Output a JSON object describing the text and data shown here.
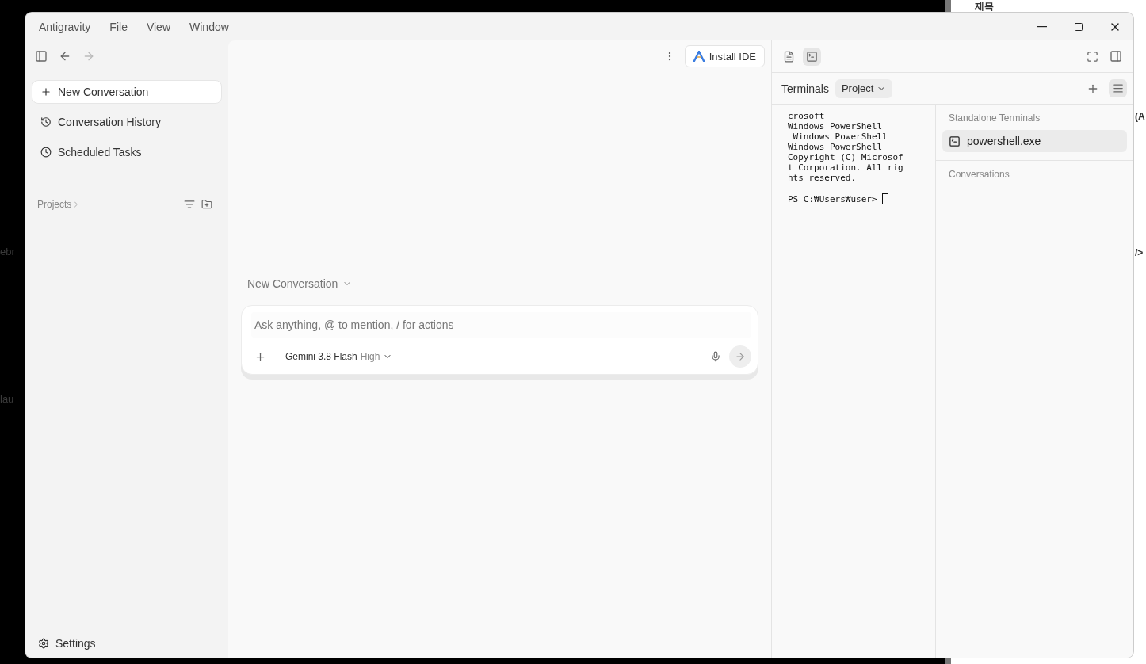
{
  "desktop": {
    "left_texts": [
      "ebr",
      "lau"
    ],
    "back_window_texts": [
      "제목",
      "(A",
      "/>"
    ]
  },
  "window": {
    "menu": [
      "Antigravity",
      "File",
      "View",
      "Window"
    ]
  },
  "sidebar": {
    "items": [
      {
        "kind": "new",
        "label": "New Conversation",
        "selected": true
      },
      {
        "kind": "history",
        "label": "Conversation History",
        "selected": false
      },
      {
        "kind": "scheduled",
        "label": "Scheduled Tasks",
        "selected": false
      }
    ],
    "projects_label": "Projects",
    "settings": "Settings"
  },
  "center": {
    "install_button": "Install IDE",
    "mode": "New Conversation",
    "input": {
      "placeholder": "Ask anything, @ to mention, / for actions"
    },
    "model": {
      "name": "Gemini 3.8 Flash",
      "effort": "High"
    }
  },
  "right_panel": {
    "view_tabs": [
      {
        "kind": "document",
        "selected": false
      },
      {
        "kind": "terminal",
        "selected": true
      }
    ],
    "title": "Terminals",
    "scope": "Project",
    "output": [
      "crosoft",
      "Windows PowerShell",
      " Windows PowerShell",
      "Windows PowerShell",
      "Copyright (C) Microsof",
      "t Corporation. All rig",
      "hts reserved."
    ],
    "prompt": "PS C:₩Users₩user>",
    "sections": [
      {
        "title": "Standalone Terminals",
        "items": [
          {
            "label": "powershell.exe",
            "selected": true
          }
        ]
      },
      {
        "title": "Conversations"
      }
    ]
  }
}
